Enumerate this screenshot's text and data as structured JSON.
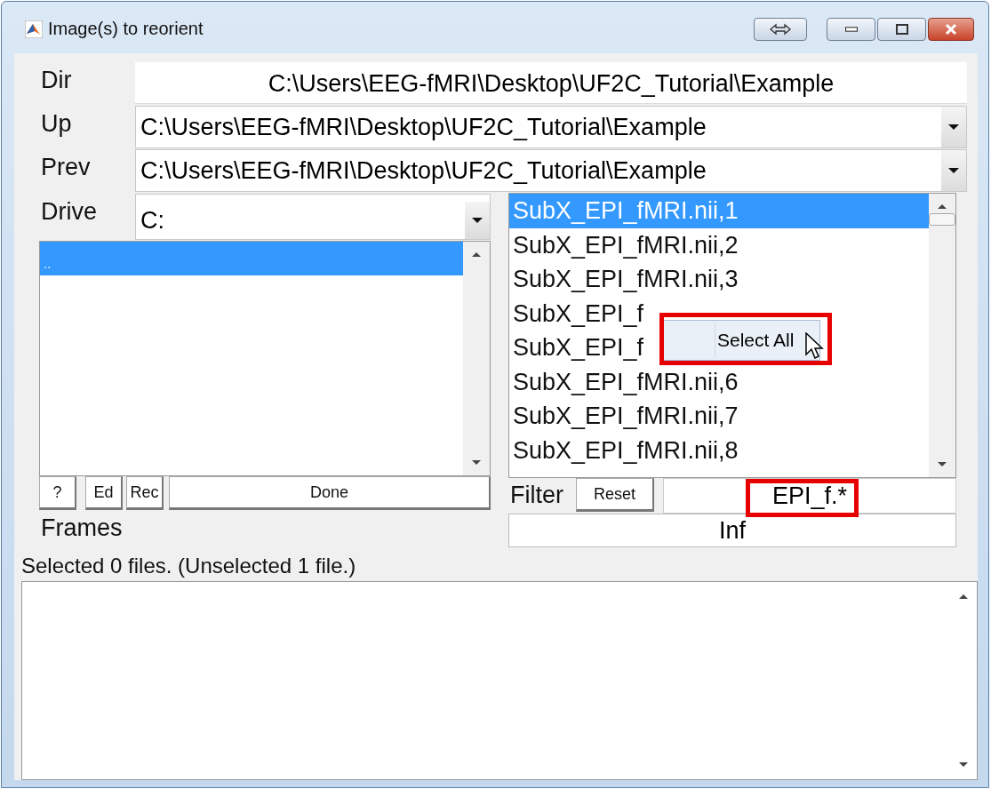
{
  "window": {
    "title": "Image(s) to reorient"
  },
  "paths": [
    {
      "kind": "text",
      "label": "Dir",
      "value": "C:\\Users\\EEG-fMRI\\Desktop\\UF2C_Tutorial\\Example"
    },
    {
      "kind": "popup",
      "label": "Up",
      "value": "C:\\Users\\EEG-fMRI\\Desktop\\UF2C_Tutorial\\Example"
    },
    {
      "kind": "popup",
      "label": "Prev",
      "value": "C:\\Users\\EEG-fMRI\\Desktop\\UF2C_Tutorial\\Example"
    }
  ],
  "drive": {
    "label": "Drive",
    "value": "C:"
  },
  "directories": [
    {
      "text": "..",
      "selected": true
    }
  ],
  "buttons": [
    "?",
    "Ed",
    "Rec",
    "Done"
  ],
  "frames": {
    "label": "Frames",
    "value": "Inf"
  },
  "files": [
    {
      "text": "SubX_EPI_fMRI.nii,1",
      "selected": true
    },
    {
      "text": "SubX_EPI_fMRI.nii,2",
      "selected": false
    },
    {
      "text": "SubX_EPI_fMRI.nii,3",
      "selected": false
    },
    {
      "text": "SubX_EPI_f",
      "selected": false
    },
    {
      "text": "SubX_EPI_f",
      "selected": false
    },
    {
      "text": "SubX_EPI_fMRI.nii,6",
      "selected": false
    },
    {
      "text": "SubX_EPI_fMRI.nii,7",
      "selected": false
    },
    {
      "text": "SubX_EPI_fMRI.nii,8",
      "selected": false
    }
  ],
  "filter": {
    "label": "Filter",
    "reset": "Reset",
    "value": "EPI_f.*"
  },
  "context_menu": {
    "items": [
      "Select All"
    ]
  },
  "status": "Selected 0 files. (Unselected 1 file.)"
}
